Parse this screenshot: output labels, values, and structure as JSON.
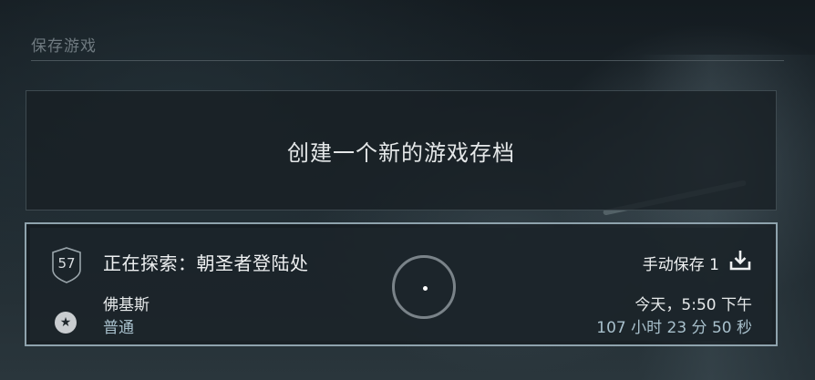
{
  "header": {
    "title": "保存游戏"
  },
  "new_save": {
    "label": "创建一个新的游戏存档"
  },
  "save_slots": [
    {
      "level": "57",
      "location": "正在探索：朝圣者登陆处",
      "character": "佛基斯",
      "difficulty": "普通",
      "save_type": "手动保存 1",
      "save_time": "今天，5:50 下午",
      "playtime": "107 小时 23 分 50 秒",
      "icons": {
        "level": "shield-level-icon",
        "difficulty": "star-icon",
        "save": "download-icon",
        "loading": "loading-spinner-icon"
      }
    }
  ],
  "colors": {
    "slot_border": "#8fa3ad",
    "secondary_text": "#a8c0cc",
    "title_text": "#6f7a80"
  }
}
